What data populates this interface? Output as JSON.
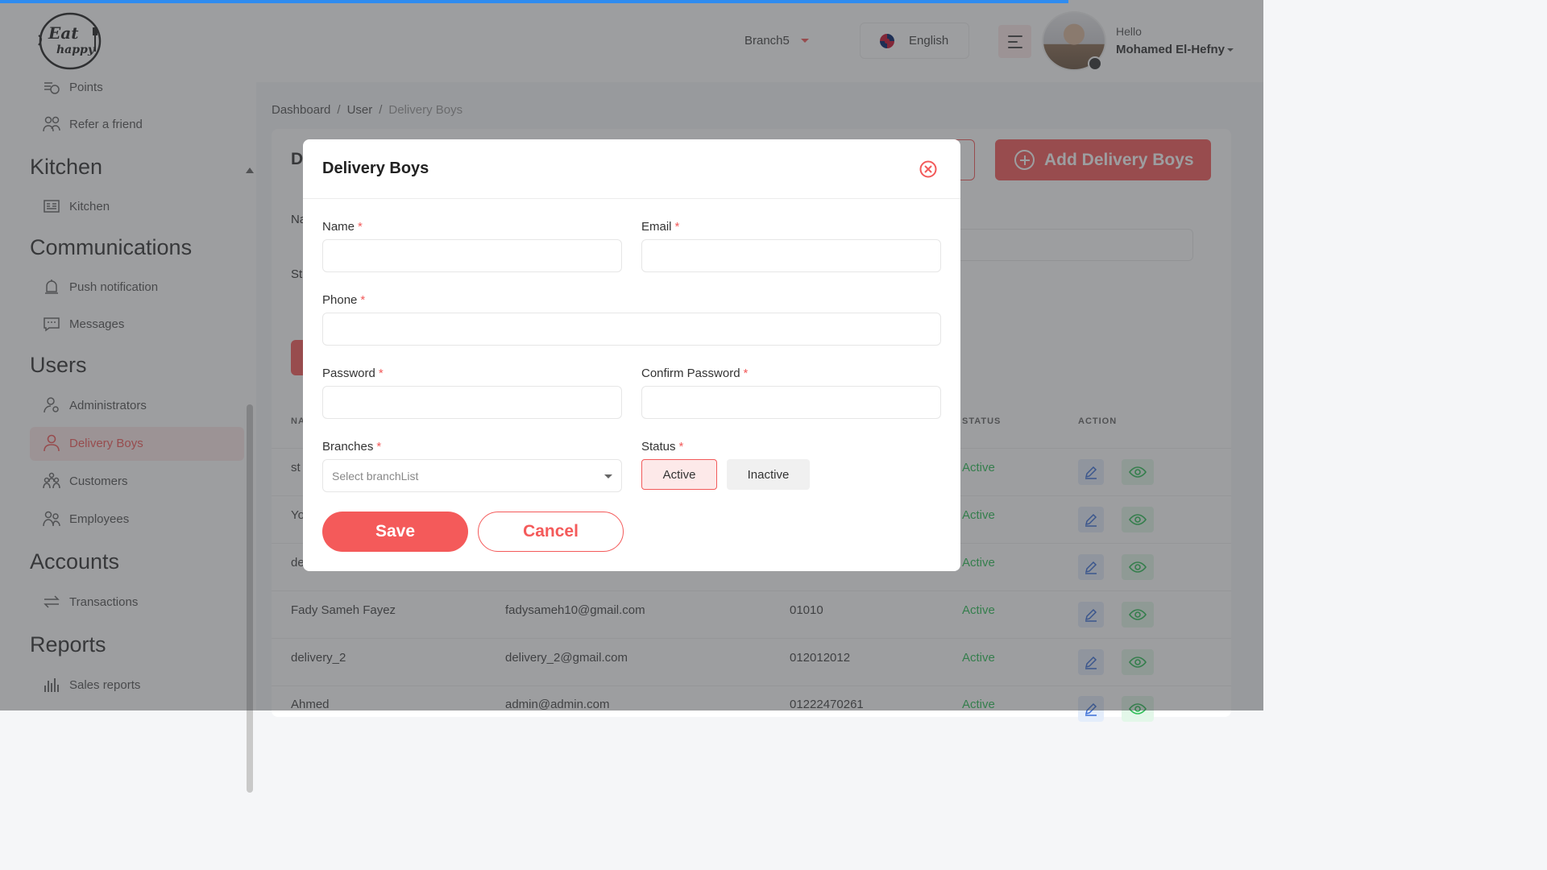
{
  "header": {
    "logo_text_top": "Eat",
    "logo_text_bottom": "happy",
    "branch": "Branch5",
    "language": "English",
    "greeting": "Hello",
    "user_name": "Mohamed El-Hefny"
  },
  "sidebar": {
    "items_top": [
      {
        "label": "Points",
        "icon": "points-icon"
      },
      {
        "label": "Refer a friend",
        "icon": "refer-friend-icon"
      }
    ],
    "sections": [
      {
        "title": "Kitchen",
        "items": [
          {
            "label": "Kitchen"
          }
        ]
      },
      {
        "title": "Communications",
        "items": [
          {
            "label": "Push notification"
          },
          {
            "label": "Messages"
          }
        ]
      },
      {
        "title": "Users",
        "items": [
          {
            "label": "Administrators"
          },
          {
            "label": "Delivery Boys"
          },
          {
            "label": "Customers"
          },
          {
            "label": "Employees"
          }
        ]
      },
      {
        "title": "Accounts",
        "items": [
          {
            "label": "Transactions"
          }
        ]
      },
      {
        "title": "Reports",
        "items": [
          {
            "label": "Sales reports"
          }
        ]
      }
    ]
  },
  "breadcrumb": [
    "Dashboard",
    "User",
    "Delivery Boys"
  ],
  "main": {
    "add_button": "Add Delivery Boys",
    "title_fragment": "D",
    "name_fragment": "Na",
    "status_fragment": "St",
    "table": {
      "headers": {
        "name_fragment": "NA",
        "status": "STATUS",
        "action": "ACTION"
      },
      "rows": [
        {
          "name": "st",
          "email": "",
          "phone": "",
          "status": "Active"
        },
        {
          "name": "Yo",
          "email": "",
          "phone": "",
          "status": "Active"
        },
        {
          "name": "de",
          "email": "",
          "phone": "",
          "status": "Active"
        },
        {
          "name": "Fady Sameh Fayez",
          "email": "fadysameh10@gmail.com",
          "phone": "01010",
          "status": "Active"
        },
        {
          "name": "delivery_2",
          "email": "delivery_2@gmail.com",
          "phone": "012012012",
          "status": "Active"
        },
        {
          "name": "Ahmed",
          "email": "admin@admin.com",
          "phone": "01222470261",
          "status": "Active"
        }
      ]
    }
  },
  "modal": {
    "title": "Delivery Boys",
    "fields": {
      "name_label": "Name",
      "email_label": "Email",
      "phone_label": "Phone",
      "password_label": "Password",
      "confirm_password_label": "Confirm Password",
      "branches_label": "Branches",
      "branches_placeholder": "Select branchList",
      "status_label": "Status",
      "required_mark": "*"
    },
    "status_options": [
      "Active",
      "Inactive"
    ],
    "selected_status": "Active",
    "save": "Save",
    "cancel": "Cancel"
  },
  "colors": {
    "accent": "#f45a5a",
    "active_text": "#2fbf58",
    "progress": "#2f8cf0"
  }
}
